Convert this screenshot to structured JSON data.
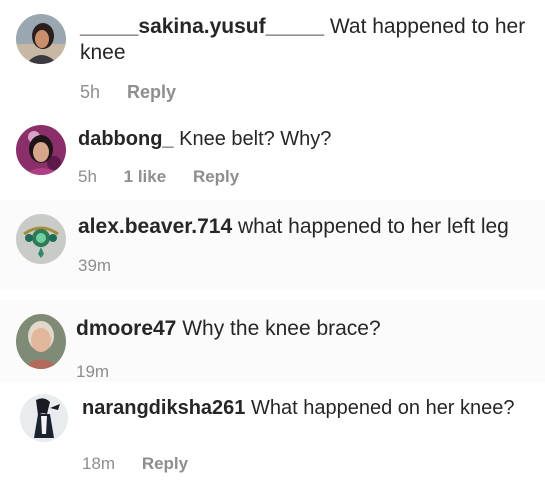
{
  "comments": [
    {
      "username": "_____sakina.yusuf_____",
      "text": "Wat happened to her knee",
      "time": "5h",
      "likes": "",
      "reply_label": "Reply",
      "avatar_icon": "profile-photo-woman-dark-hair"
    },
    {
      "username": "dabbong_",
      "text": "Knee  belt? Why?",
      "time": "5h",
      "likes": "1 like",
      "reply_label": "Reply",
      "avatar_icon": "profile-photo-woman-illustration"
    },
    {
      "username": "alex.beaver.714",
      "text": "what happened to her left leg",
      "time": "39m",
      "likes": "",
      "reply_label": "",
      "avatar_icon": "profile-photo-jewel-pendant"
    },
    {
      "username": "dmoore47",
      "text": "Why the knee brace?",
      "time": "19m",
      "likes": "",
      "reply_label": "",
      "avatar_icon": "profile-photo-older-woman"
    },
    {
      "username": "narangdiksha261",
      "text": "What happened on her knee?",
      "time": "18m",
      "likes": "",
      "reply_label": "Reply",
      "avatar_icon": "profile-photo-figure-silhouette"
    }
  ]
}
